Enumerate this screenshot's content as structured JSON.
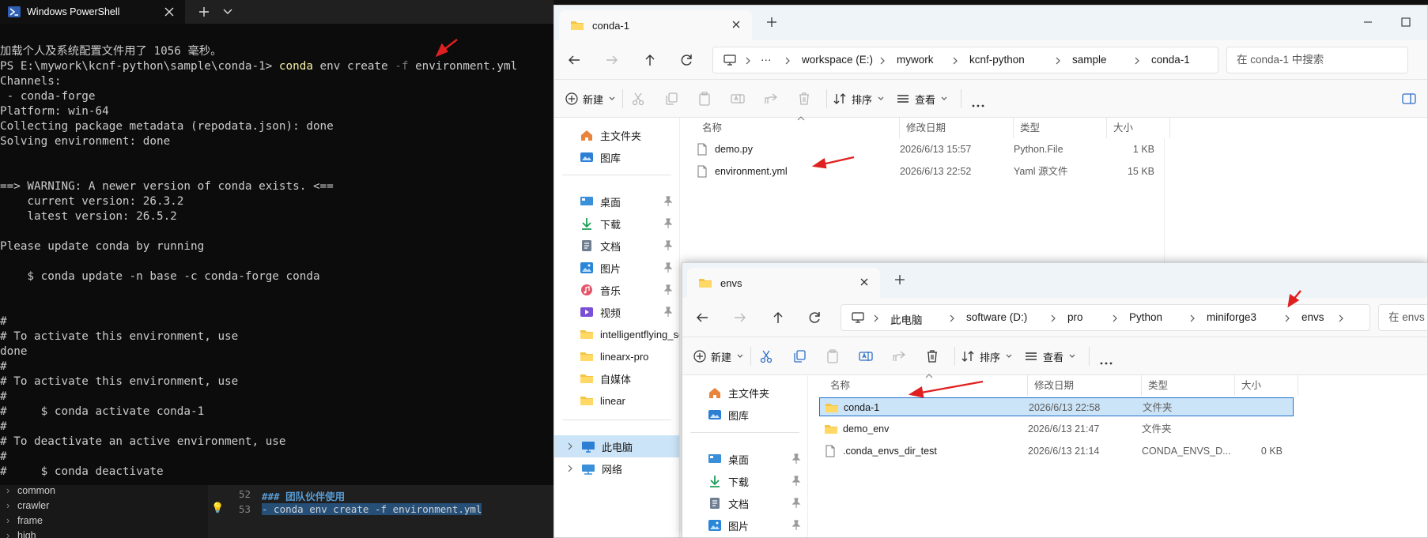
{
  "powershell": {
    "tab_title": "Windows PowerShell",
    "lines": [
      {
        "t": "加载个人及系统配置文件用了 1056 毫秒。"
      },
      {
        "prompt": "PS E:\\mywork\\kcnf-python\\sample\\conda-1> ",
        "cmd": "conda",
        "rest1": " env create ",
        "flag": "-f",
        "rest2": " environment.yml"
      },
      {
        "t": "Channels:"
      },
      {
        "t": " - conda-forge"
      },
      {
        "t": "Platform: win-64"
      },
      {
        "t": "Collecting package metadata (repodata.json): done"
      },
      {
        "t": "Solving environment: done"
      },
      {
        "t": ""
      },
      {
        "t": ""
      },
      {
        "t": "==> WARNING: A newer version of conda exists. <=="
      },
      {
        "t": "    current version: 26.3.2"
      },
      {
        "t": "    latest version: 26.5.2"
      },
      {
        "t": ""
      },
      {
        "t": "Please update conda by running"
      },
      {
        "t": ""
      },
      {
        "t": "    $ conda update -n base -c conda-forge conda"
      },
      {
        "t": ""
      },
      {
        "t": ""
      },
      {
        "t": "#"
      },
      {
        "t": "# To activate this environment, use"
      },
      {
        "t": "done"
      },
      {
        "t": "#"
      },
      {
        "t": "# To activate this environment, use"
      },
      {
        "t": "#"
      },
      {
        "t": "#     $ conda activate conda-1"
      },
      {
        "t": "#"
      },
      {
        "t": "# To deactivate an active environment, use"
      },
      {
        "t": "#"
      },
      {
        "t": "#     $ conda deactivate"
      }
    ]
  },
  "editor": {
    "tree": [
      "common",
      "crawler",
      "frame",
      "high"
    ],
    "lines": [
      {
        "num": "52",
        "text": "### 团队伙伴使用"
      },
      {
        "num": "53",
        "text": "- conda env create -f environment.yml"
      }
    ]
  },
  "explorer1": {
    "tab_title": "conda-1",
    "breadcrumb": [
      "workspace (E:)",
      "mywork",
      "kcnf-python",
      "sample",
      "conda-1"
    ],
    "search_placeholder": "在 conda-1 中搜索",
    "commands": {
      "new": "新建",
      "sort": "排序",
      "view": "查看"
    },
    "sidebar": [
      {
        "label": "主文件夹",
        "icon": "home-icon",
        "pin": false
      },
      {
        "label": "图库",
        "icon": "gallery-icon",
        "pin": false
      },
      {
        "label": "桌面",
        "icon": "desktop-icon",
        "pin": true
      },
      {
        "label": "下载",
        "icon": "download-icon",
        "pin": true
      },
      {
        "label": "文档",
        "icon": "documents-icon",
        "pin": true
      },
      {
        "label": "图片",
        "icon": "pictures-icon",
        "pin": true
      },
      {
        "label": "音乐",
        "icon": "music-icon",
        "pin": true
      },
      {
        "label": "视频",
        "icon": "videos-icon",
        "pin": true
      },
      {
        "label": "intelligentflying_se",
        "icon": "folder-icon",
        "pin": false
      },
      {
        "label": "linearx-pro",
        "icon": "folder-icon",
        "pin": false
      },
      {
        "label": "自媒体",
        "icon": "folder-icon",
        "pin": false
      },
      {
        "label": "linear",
        "icon": "folder-icon",
        "pin": false
      },
      {
        "label": "此电脑",
        "icon": "this-pc-icon",
        "pin": false
      },
      {
        "label": "网络",
        "icon": "network-icon",
        "pin": false
      }
    ],
    "columns": [
      "名称",
      "修改日期",
      "类型",
      "大小"
    ],
    "files": [
      {
        "name": "demo.py",
        "date": "2026/6/13 15:57",
        "type": "Python.File",
        "size": "1 KB"
      },
      {
        "name": "environment.yml",
        "date": "2026/6/13 22:52",
        "type": "Yaml 源文件",
        "size": "15 KB"
      }
    ]
  },
  "explorer2": {
    "tab_title": "envs",
    "breadcrumb": [
      "此电脑",
      "software (D:)",
      "pro",
      "Python",
      "miniforge3",
      "envs"
    ],
    "search_placeholder": "在 envs 中搜索",
    "commands": {
      "new": "新建",
      "sort": "排序",
      "view": "查看"
    },
    "sidebar": [
      {
        "label": "主文件夹",
        "icon": "home-icon",
        "pin": false
      },
      {
        "label": "图库",
        "icon": "gallery-icon",
        "pin": false
      },
      {
        "label": "桌面",
        "icon": "desktop-icon",
        "pin": true
      },
      {
        "label": "下载",
        "icon": "download-icon",
        "pin": true
      },
      {
        "label": "文档",
        "icon": "documents-icon",
        "pin": true
      },
      {
        "label": "图片",
        "icon": "pictures-icon",
        "pin": true
      }
    ],
    "columns": [
      "名称",
      "修改日期",
      "类型",
      "大小"
    ],
    "files": [
      {
        "name": "conda-1",
        "date": "2026/6/13 22:58",
        "type": "文件夹",
        "size": ""
      },
      {
        "name": "demo_env",
        "date": "2026/6/13 21:47",
        "type": "文件夹",
        "size": ""
      },
      {
        "name": ".conda_envs_dir_test",
        "date": "2026/6/13 21:14",
        "type": "CONDA_ENVS_D...",
        "size": "0 KB"
      }
    ]
  },
  "colors": {
    "annotation_arrow": "#e02020",
    "folder": "#f4c542",
    "accent": "#1f6fcb",
    "selection": "#cce4f7"
  }
}
